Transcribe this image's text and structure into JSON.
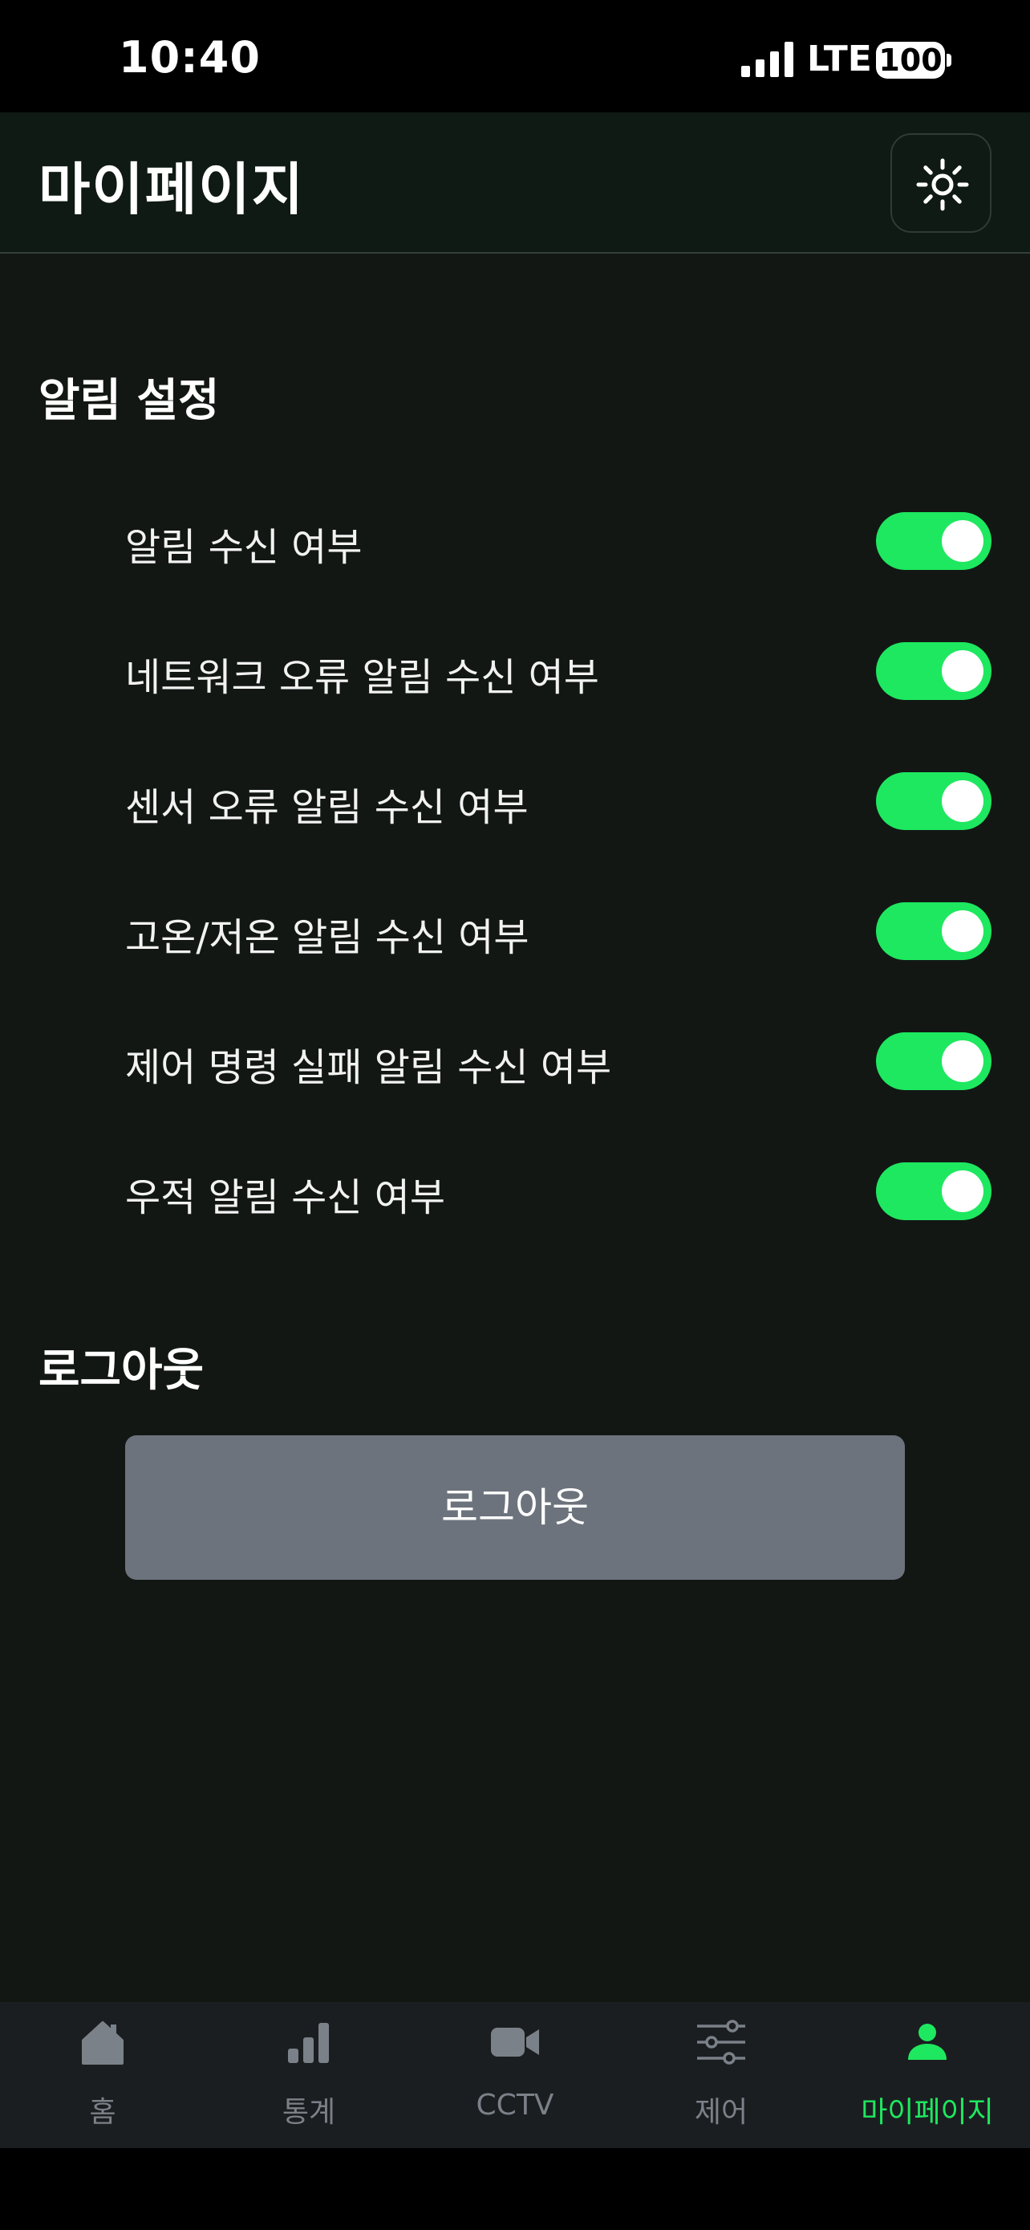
{
  "status_bar": {
    "time": "10:40",
    "network": "LTE",
    "battery": "100"
  },
  "header": {
    "title": "마이페이지",
    "theme_icon": "sun-icon"
  },
  "notification_section": {
    "title": "알림 설정",
    "items": [
      {
        "label": "알림 수신 여부",
        "enabled": true
      },
      {
        "label": "네트워크 오류 알림 수신 여부",
        "enabled": true
      },
      {
        "label": "센서 오류 알림 수신 여부",
        "enabled": true
      },
      {
        "label": "고온/저온 알림 수신 여부",
        "enabled": true
      },
      {
        "label": "제어 명령 실패 알림 수신 여부",
        "enabled": true
      },
      {
        "label": "우적 알림 수신 여부",
        "enabled": true
      }
    ]
  },
  "logout_section": {
    "title": "로그아웃",
    "button_label": "로그아웃"
  },
  "tab_bar": {
    "tabs": [
      {
        "label": "홈",
        "icon": "home-icon",
        "active": false
      },
      {
        "label": "통계",
        "icon": "bar-chart-icon",
        "active": false
      },
      {
        "label": "CCTV",
        "icon": "video-camera-icon",
        "active": false
      },
      {
        "label": "제어",
        "icon": "sliders-icon",
        "active": false
      },
      {
        "label": "마이페이지",
        "icon": "user-icon",
        "active": true
      }
    ]
  },
  "colors": {
    "accent": "#1ee85f",
    "background": "#121714",
    "header": "#0f1a14",
    "button": "#6c737c",
    "tab_inactive": "#7b8188"
  }
}
